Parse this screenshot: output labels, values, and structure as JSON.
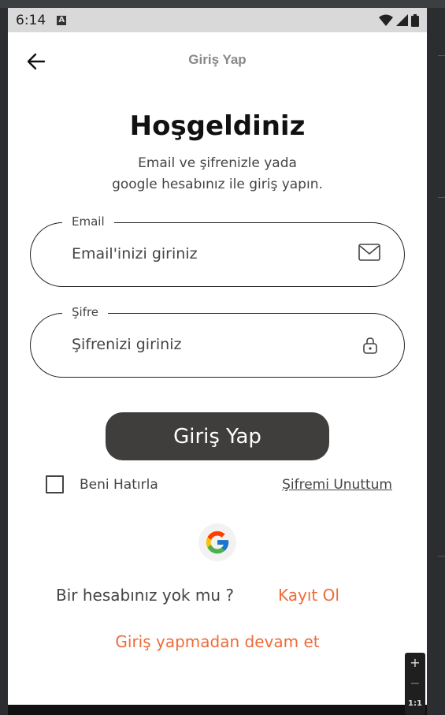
{
  "statusbar": {
    "time": "6:14",
    "a_label": "A"
  },
  "appbar": {
    "title": "Giriş Yap"
  },
  "welcome": {
    "title": "Hoşgeldiniz",
    "subtitle_line1": "Email ve şifrenizle yada",
    "subtitle_line2": "google hesabınız ile giriş yapın."
  },
  "email": {
    "label": "Email",
    "placeholder": "Email'inizi giriniz"
  },
  "password": {
    "label": "Şifre",
    "placeholder": "Şifrenizi giriniz"
  },
  "login_button": "Giriş Yap",
  "remember_label": "Beni Hatırla",
  "forgot_label": "Şifremi Unuttum",
  "no_account_text": "Bir hesabınız yok mu ?",
  "signup_label": "Kayıt Ol",
  "guest_label": "Giriş yapmadan devam et",
  "zoom": {
    "plus": "+",
    "minus": "−",
    "reset": "1:1"
  },
  "colors": {
    "accent": "#ef6b39",
    "button": "#403e3c",
    "statusbar": "#d9d9d9"
  },
  "icons": [
    "back-arrow-icon",
    "mail-icon",
    "lock-icon",
    "google-icon",
    "wifi-icon",
    "signal-icon",
    "battery-icon"
  ]
}
